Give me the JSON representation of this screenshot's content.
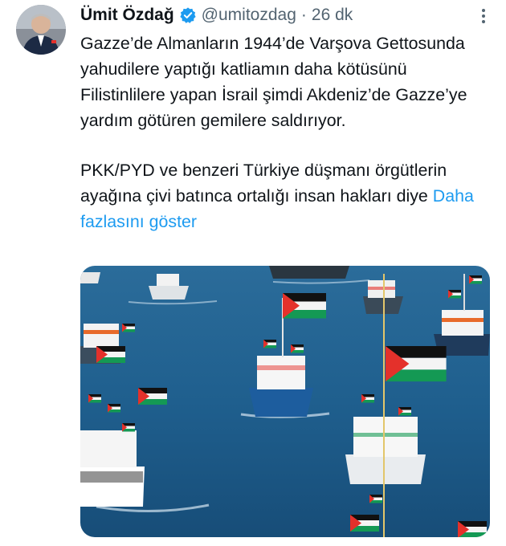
{
  "tweet": {
    "author_name": "Ümit Özdağ",
    "handle": "@umitozdag",
    "separator": "·",
    "time": "26 dk",
    "paragraph1": "Gazze’de Almanların 1944’de Varşova Gettosunda yahudilere yaptığı katliamın daha kötüsünü Filistinlilere yapan İsrail şimdi Akdeniz’de Gazze’ye yardım götüren gemilere saldırıyor.",
    "paragraph2": "PKK/PYD ve benzeri Türkiye düşmanı örgütlerin ayağına çivi batınca ortalığı insan hakları diye ",
    "show_more": "Daha fazlasını göster"
  },
  "icons": {
    "verified": "verified-badge-icon",
    "more": "more-options-icon"
  },
  "colors": {
    "link": "#1d9bf0",
    "secondary_text": "#536471",
    "verified": "#1d9bf0",
    "sea": "#1d5c8c",
    "flag_green": "#149954",
    "flag_red": "#e4312b"
  }
}
